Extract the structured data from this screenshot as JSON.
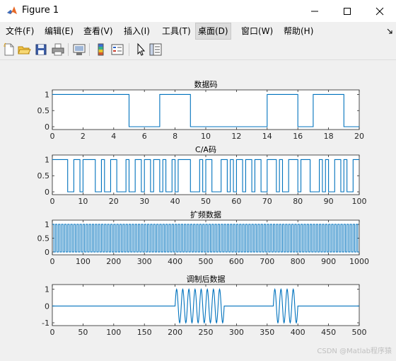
{
  "window": {
    "title": "Figure 1"
  },
  "menu": [
    "文件(F)",
    "编辑(E)",
    "查看(V)",
    "插入(I)",
    "工具(T)",
    "桌面(D)",
    "窗口(W)",
    "帮助(H)"
  ],
  "menu_active": "桌面(D)",
  "toolbar_icons": [
    "new-figure-icon",
    "open-file-icon",
    "save-icon",
    "print-icon",
    "link-plot-icon",
    "colorbar-icon",
    "legend-icon",
    "edit-plot-arrow-icon",
    "property-inspector-icon"
  ],
  "accent_color": "#0072bd",
  "watermark": "CSDN @Matlab程序猿",
  "chart_data": [
    {
      "type": "line",
      "title": "数据码",
      "xlim": [
        0,
        20
      ],
      "ylim": [
        0,
        1
      ],
      "xticks": [
        0,
        2,
        4,
        6,
        8,
        10,
        12,
        14,
        16,
        18,
        20
      ],
      "yticks": [
        0,
        0.5,
        1
      ],
      "ytick_labels": [
        "0",
        "0.5",
        "1"
      ],
      "step_bits": [
        1,
        1,
        1,
        1,
        1,
        0,
        0,
        1,
        1,
        0,
        0,
        0,
        0,
        0,
        1,
        1,
        0,
        1,
        1,
        0
      ]
    },
    {
      "type": "line",
      "title": "C/A码",
      "xlim": [
        0,
        100
      ],
      "ylim": [
        0,
        1
      ],
      "xticks": [
        0,
        10,
        20,
        30,
        40,
        50,
        60,
        70,
        80,
        90,
        100
      ],
      "yticks": [
        0,
        0.5,
        1
      ],
      "ytick_labels": [
        "0",
        "0.5",
        "1"
      ],
      "transitions": [
        5,
        7,
        9,
        10,
        14,
        16,
        17,
        19,
        21,
        24,
        25,
        27,
        29,
        30,
        32,
        33,
        35,
        36,
        37,
        39,
        40,
        41,
        45,
        48,
        49,
        50,
        52,
        55,
        57,
        58,
        59,
        60,
        62,
        63,
        65,
        66,
        68,
        70,
        73,
        74,
        75,
        77,
        80,
        81,
        84,
        87,
        88,
        89,
        90,
        92,
        94,
        95,
        96,
        98
      ]
    },
    {
      "type": "line",
      "title": "扩频数据",
      "xlim": [
        0,
        1000
      ],
      "ylim": [
        0,
        1
      ],
      "xticks": [
        0,
        100,
        200,
        300,
        400,
        500,
        600,
        700,
        800,
        900,
        1000
      ],
      "yticks": [
        0,
        0.5,
        1
      ],
      "ytick_labels": [
        "0",
        "0.5",
        "1"
      ],
      "toggle_period": 5
    },
    {
      "type": "line",
      "title": "调制后数据",
      "xlim": [
        0,
        500
      ],
      "ylim": [
        -1,
        1
      ],
      "xticks": [
        0,
        50,
        100,
        150,
        200,
        250,
        300,
        350,
        400,
        450,
        500
      ],
      "yticks": [
        -1,
        0,
        1
      ],
      "ytick_labels": [
        "-1",
        "0",
        "1"
      ],
      "bursts": [
        {
          "start": 200,
          "end": 280,
          "period": 10
        },
        {
          "start": 360,
          "end": 400,
          "period": 10
        }
      ]
    }
  ]
}
